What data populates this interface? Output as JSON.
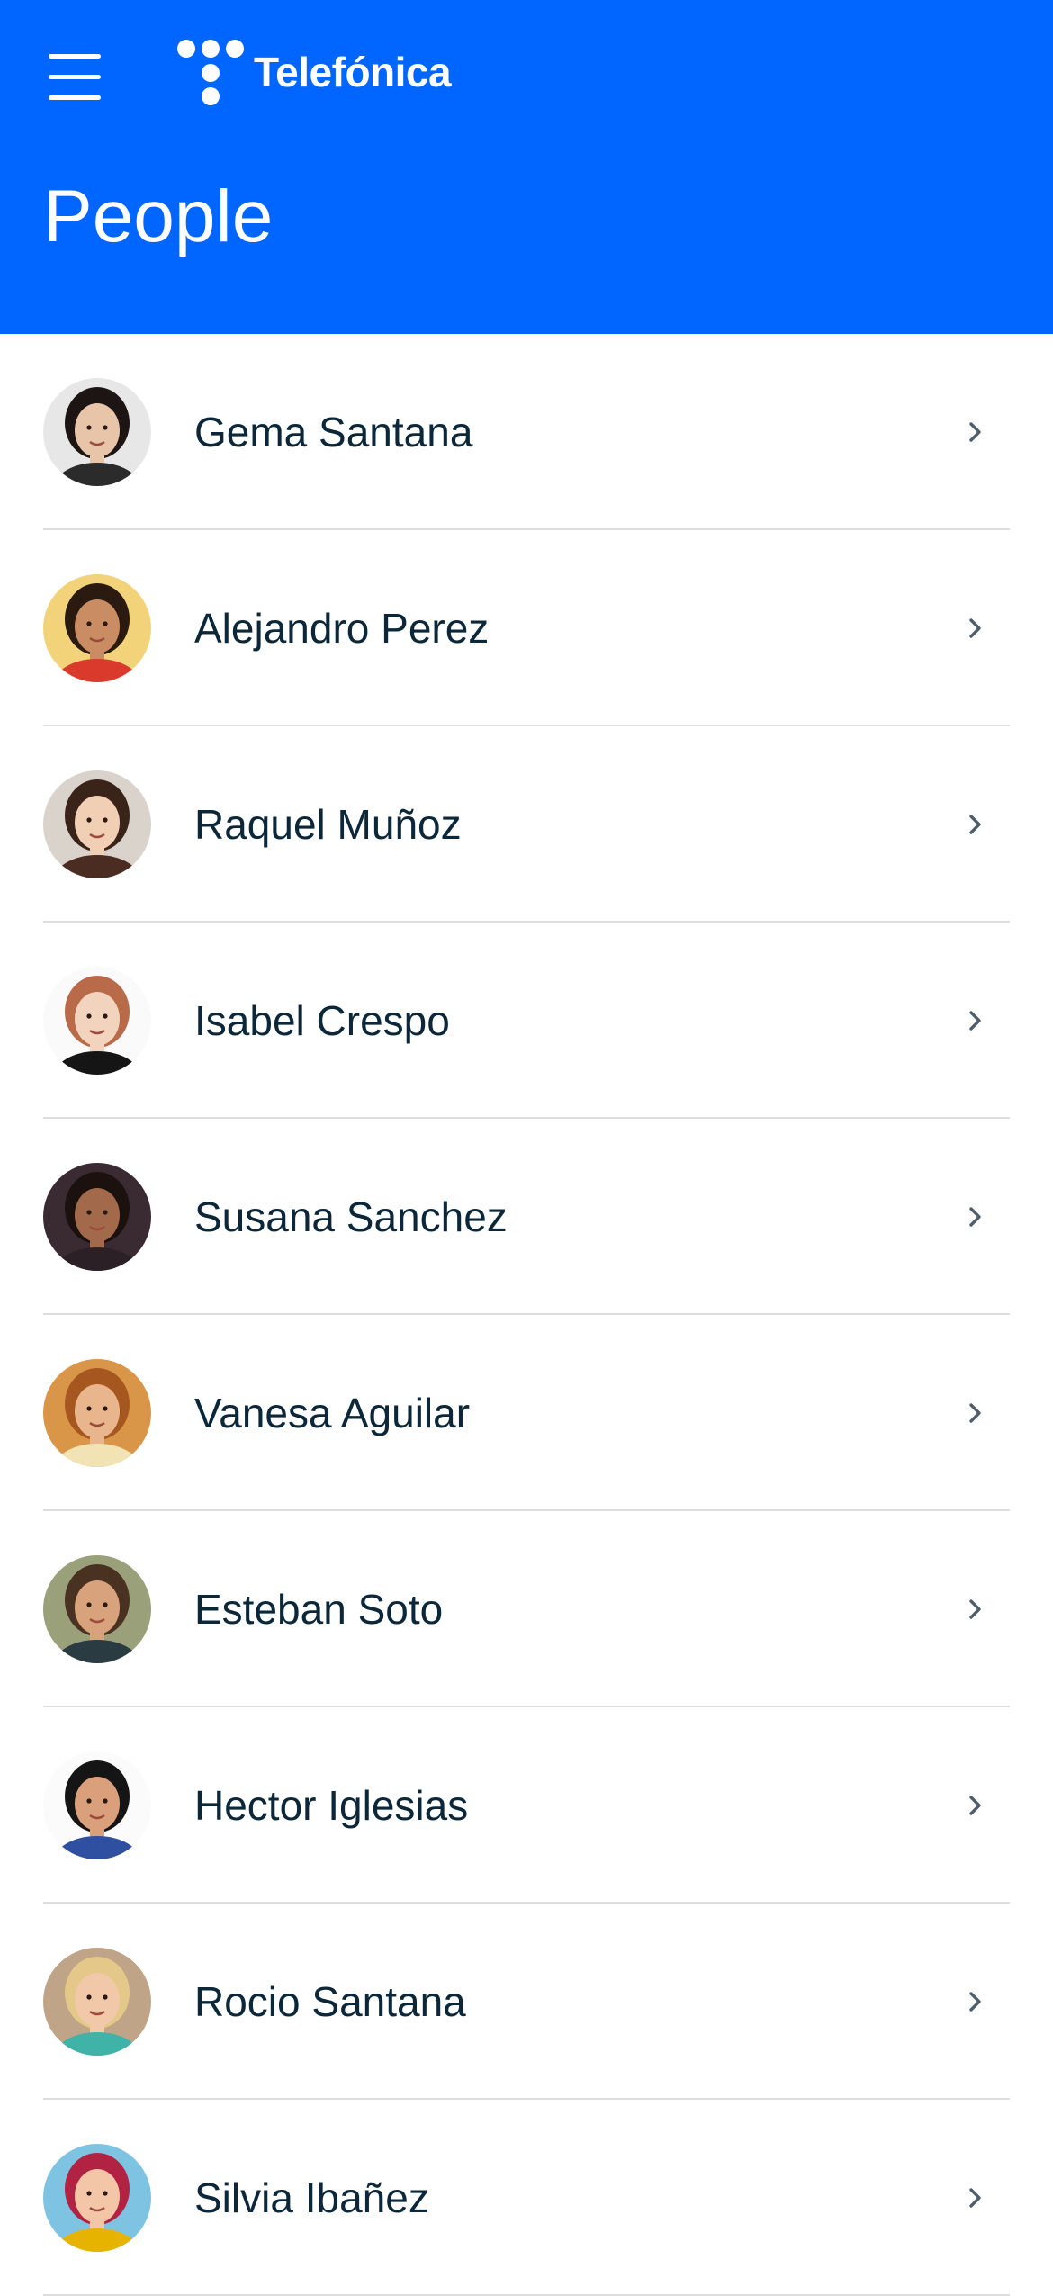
{
  "header": {
    "menu_icon": "hamburger-menu-icon",
    "brand_name": "Telefónica",
    "brand_icon": "telefonica-dots-logo",
    "page_title": "People",
    "background_color": "#0066ff"
  },
  "people": [
    {
      "name": "Gema Santana",
      "skin": "#e8c4a9",
      "hair": "#1d1513",
      "shirt": "#2b2b2b",
      "bg": "#e7e7e7"
    },
    {
      "name": "Alejandro Perez",
      "skin": "#c98c63",
      "hair": "#2a1a10",
      "shirt": "#d93a2b",
      "bg": "#f3d37a"
    },
    {
      "name": "Raquel Muñoz",
      "skin": "#f0cfb5",
      "hair": "#3a2318",
      "shirt": "#4a2c22",
      "bg": "#d9d3cc"
    },
    {
      "name": "Isabel Crespo",
      "skin": "#f2d3bd",
      "hair": "#b86a49",
      "shirt": "#151515",
      "bg": "#fafafa"
    },
    {
      "name": "Susana Sanchez",
      "skin": "#a26a4a",
      "hair": "#1b1210",
      "shirt": "#2a2026",
      "bg": "#3a2b33"
    },
    {
      "name": "Vanesa Aguilar",
      "skin": "#e9b58d",
      "hair": "#a5571f",
      "shirt": "#f1e3b4",
      "bg": "#d99548"
    },
    {
      "name": "Esteban Soto",
      "skin": "#d7a27c",
      "hair": "#4a3222",
      "shirt": "#2a3b42",
      "bg": "#9aa07a"
    },
    {
      "name": "Hector Iglesias",
      "skin": "#d9a07b",
      "hair": "#151515",
      "shirt": "#2f4fa0",
      "bg": "#fbfbfb"
    },
    {
      "name": "Rocio Santana",
      "skin": "#f1c8a8",
      "hair": "#e4c889",
      "shirt": "#3fb3a8",
      "bg": "#bfa488"
    },
    {
      "name": "Silvia Ibañez",
      "skin": "#f3c6a8",
      "hair": "#b22242",
      "shirt": "#e6b400",
      "bg": "#7fc3e2"
    }
  ],
  "row_chevron_icon": "chevron-right-icon"
}
